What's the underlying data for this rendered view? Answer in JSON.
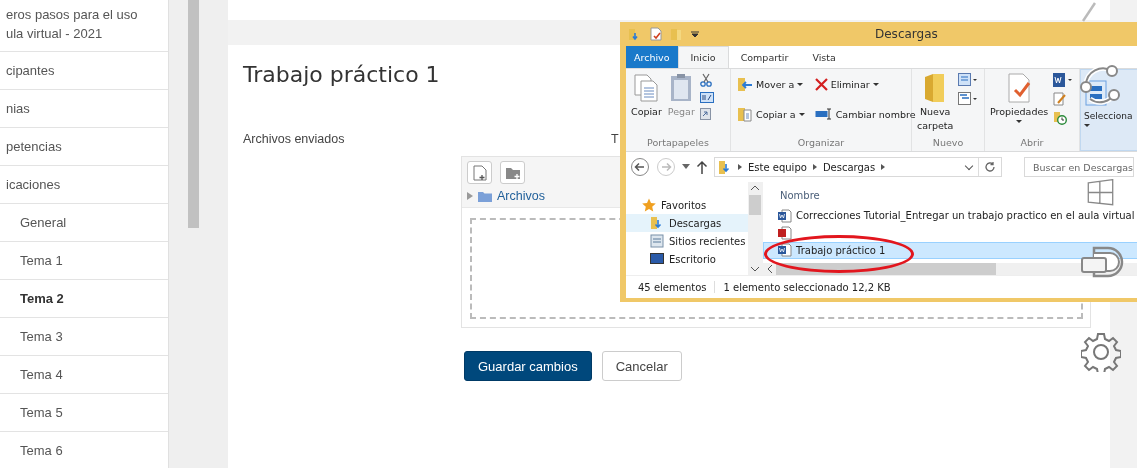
{
  "sidebar": {
    "course_title_lines": [
      "eros pasos para el uso",
      "ula virtual - 2021"
    ],
    "links": [
      {
        "label": "cipantes"
      },
      {
        "label": "nias"
      },
      {
        "label": "petencias"
      },
      {
        "label": "icaciones"
      }
    ],
    "sections": [
      {
        "label": "General",
        "selected": false
      },
      {
        "label": "Tema 1",
        "selected": false
      },
      {
        "label": "Tema 2",
        "selected": true
      },
      {
        "label": "Tema 3",
        "selected": false
      },
      {
        "label": "Tema 4",
        "selected": false
      },
      {
        "label": "Tema 5",
        "selected": false
      },
      {
        "label": "Tema 6",
        "selected": false
      }
    ]
  },
  "main": {
    "title": "Trabajo práctico 1",
    "field_label": "Archivos enviados",
    "cut_label": "T",
    "file_picker": {
      "folder": "Archivos"
    },
    "buttons": [
      {
        "label": "Guardar cambios",
        "kind": "primary"
      },
      {
        "label": "Cancelar",
        "kind": "secondary"
      }
    ]
  },
  "explorer": {
    "title": "Descargas",
    "tabs": [
      {
        "label": "Archivo",
        "kind": "file",
        "selected": false
      },
      {
        "label": "Inicio",
        "kind": "tab",
        "selected": true
      },
      {
        "label": "Compartir",
        "kind": "tab",
        "selected": false
      },
      {
        "label": "Vista",
        "kind": "tab",
        "selected": false
      }
    ],
    "ribbon": {
      "copy": {
        "label": "Copiar",
        "disabled": false
      },
      "paste": {
        "label": "Pegar",
        "disabled": true
      },
      "clipboard_group": "Portapapeles",
      "organize": [
        {
          "label": "Mover a",
          "kind": "move"
        },
        {
          "label": "Copiar a",
          "kind": "copyto"
        },
        {
          "label": "Eliminar",
          "kind": "delete"
        },
        {
          "label": "Cambiar nombre",
          "kind": "rename"
        }
      ],
      "organize_group": "Organizar",
      "new_folder_lines": [
        "Nueva",
        "carpeta"
      ],
      "new_group": "Nuevo",
      "properties": "Propiedades",
      "open_group": "Abrir",
      "select": "Selecciona"
    },
    "breadcrumb": [
      "Este equipo",
      "Descargas"
    ],
    "search": {
      "placeholder": "Buscar en Descargas"
    },
    "nav": [
      {
        "label": "Favoritos",
        "kind": "star",
        "selected": false
      },
      {
        "label": "Descargas",
        "kind": "downloads",
        "selected": true
      },
      {
        "label": "Sitios recientes",
        "kind": "recent",
        "selected": false
      },
      {
        "label": "Escritorio",
        "kind": "desktop",
        "selected": false
      }
    ],
    "column": "Nombre",
    "files": [
      {
        "name": "Correcciones Tutorial_Entregar un trabajo practico en el aula virtual",
        "kind": "word",
        "selected": false
      },
      {
        "kind": "pdf",
        "selected": false
      },
      {
        "name": "Trabajo práctico 1",
        "kind": "word",
        "selected": true
      }
    ],
    "status": {
      "count": "45 elementos",
      "selection": "1 elemento seleccionado  12,2 KB"
    }
  }
}
